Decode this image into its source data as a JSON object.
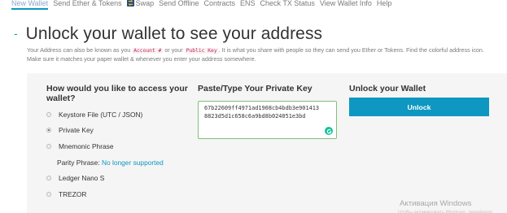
{
  "nav": {
    "items": [
      {
        "label": "New Wallet",
        "active": true
      },
      {
        "label": "Send Ether & Tokens"
      },
      {
        "label": "Swap",
        "icon": "swap-icon"
      },
      {
        "label": "Send Offline"
      },
      {
        "label": "Contracts"
      },
      {
        "label": "ENS"
      },
      {
        "label": "Check TX Status"
      },
      {
        "label": "View Wallet Info"
      },
      {
        "label": "Help"
      }
    ]
  },
  "header": {
    "dash": "-",
    "title": "Unlock your wallet to see your address"
  },
  "description": {
    "part1": "Your Address can also be known as you ",
    "code1": "Account #",
    "part2": " or your ",
    "code2": "Public Key",
    "part3": ". It is what you share with people so they can send you Ether or Tokens. Find the colorful address icon.",
    "line2": "Make sure it matches your paper wallet & whenever you enter your address somewhere."
  },
  "access": {
    "title_line1": "How would you like to access your",
    "title_line2": "wallet?",
    "options": [
      {
        "label": "Keystore File (UTC / JSON)",
        "selected": false
      },
      {
        "label": "Private Key",
        "selected": true
      },
      {
        "label": "Mnemonic Phrase",
        "selected": false
      },
      {
        "label": "Ledger Nano S",
        "selected": false
      },
      {
        "label": "TREZOR",
        "selected": false
      }
    ],
    "parity_label": "Parity Phrase: ",
    "parity_link": "No longer supported"
  },
  "private_key": {
    "title": "Paste/Type Your Private Key",
    "line1": "67b22609ff4971ad1908cb4bdb3e901413",
    "line2": "8823d5d1c658c6a9bd8b024051e3bd"
  },
  "unlock": {
    "title": "Unlock your Wallet",
    "button_label": "Unlock"
  },
  "watermark": {
    "title": "Активация Windows",
    "subtitle": "Чтобы активировать Windows, перейдите"
  },
  "colors": {
    "accent": "#0e97c0",
    "panel_bg": "#f5f5f5",
    "code_text": "#c7254e",
    "focus_border": "#7fc07a"
  }
}
